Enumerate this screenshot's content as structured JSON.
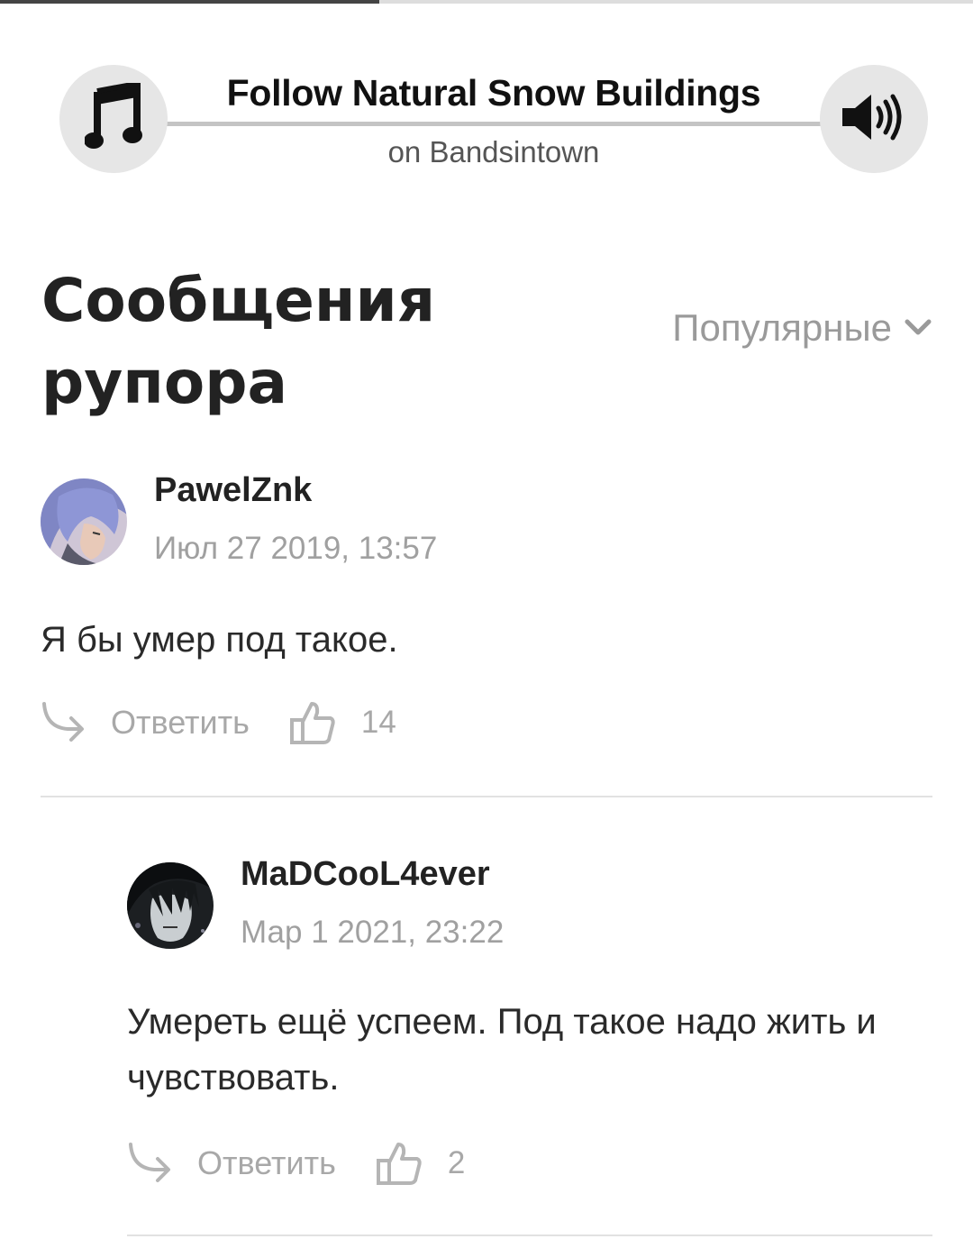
{
  "top_progress": {
    "fraction": 0.39,
    "color": "#444444"
  },
  "player": {
    "title": "Follow Natural Snow Buildings",
    "subtitle": "on Bandsintown",
    "left_icon": "music-note-icon",
    "right_icon": "speaker-volume-icon"
  },
  "section": {
    "title": "Сообщения рупора",
    "sort_label": "Популярные",
    "sort_icon": "chevron-down-icon"
  },
  "comments": [
    {
      "author": "PawelZnk",
      "date": "Июл 27 2019, 13:57",
      "text": "Я бы умер под такое.",
      "reply_label": "Ответить",
      "likes": "14"
    },
    {
      "author": "MaDCooL4ever",
      "date": "Мар 1 2021, 23:22",
      "text": "Умереть ещё успеем. Под такое надо жить и чувствовать.",
      "reply_label": "Ответить",
      "likes": "2"
    }
  ],
  "colors": {
    "text_primary": "#222222",
    "text_muted": "#a0a0a0",
    "button_bg": "#e6e6e6",
    "divider": "#e2e2e2"
  }
}
